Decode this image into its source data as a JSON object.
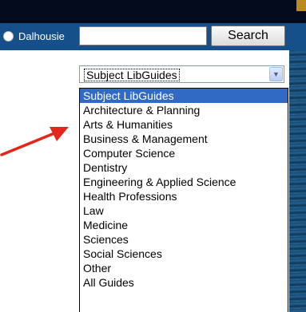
{
  "search": {
    "radio_label": "Dalhousie",
    "input_value": "",
    "button_label": "Search"
  },
  "select": {
    "current_value": "Subject LibGuides",
    "options": [
      "Subject LibGuides",
      "Architecture & Planning",
      "Arts & Humanities",
      "Business & Management",
      "Computer Science",
      "Dentistry",
      "Engineering & Applied Science",
      "Health Professions",
      "Law",
      "Medicine",
      "Sciences",
      "Social Sciences",
      "Other",
      "All Guides"
    ],
    "highlighted_index": 0
  },
  "colors": {
    "top_bar": "#020a1c",
    "search_bar": "#15508b",
    "highlight": "#316ac5",
    "arrow": "#e3261a"
  },
  "icons": {
    "dropdown_button": "chevron-down-icon",
    "annotation": "red-arrow-icon"
  }
}
